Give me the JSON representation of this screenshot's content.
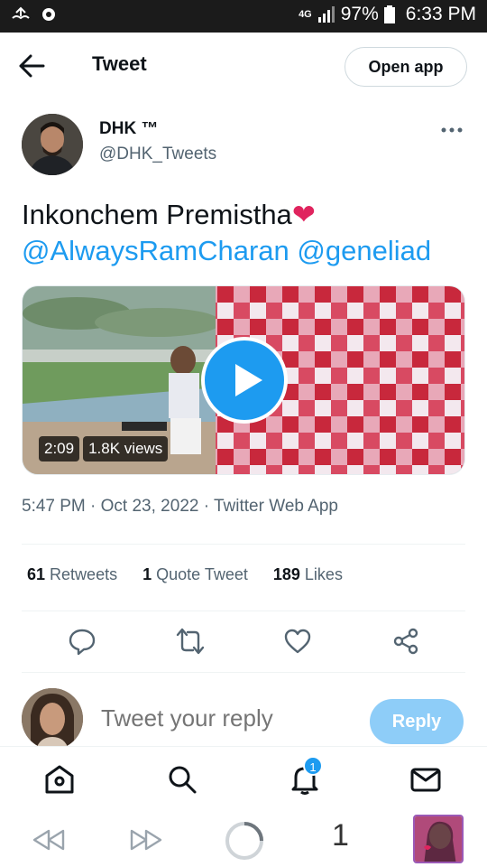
{
  "status_bar": {
    "network": "4G",
    "battery": "97%",
    "time": "6:33 PM"
  },
  "header": {
    "title": "Tweet",
    "open_app_label": "Open app"
  },
  "author": {
    "name": "DHK ™",
    "handle": "@DHK_Tweets"
  },
  "tweet": {
    "text": "Inkonchem Premistha",
    "emoji": "❤",
    "mentions": [
      "@AlwaysRamCharan",
      "@geneliad"
    ]
  },
  "video": {
    "duration": "2:09",
    "views": "1.8K views"
  },
  "meta": {
    "time": "5:47 PM",
    "date": "Oct 23, 2022",
    "source": "Twitter Web App",
    "separator": "·"
  },
  "stats": {
    "retweets_count": "61",
    "retweets_label": "Retweets",
    "quotes_count": "1",
    "quotes_label": "Quote Tweet",
    "likes_count": "189",
    "likes_label": "Likes"
  },
  "reply": {
    "placeholder": "Tweet your reply",
    "button_label": "Reply"
  },
  "bottom_nav": {
    "notifications_badge": "1",
    "items": [
      "home-icon",
      "search-icon",
      "bell-icon",
      "mail-icon"
    ]
  },
  "browser_bar": {
    "tab_count": "1"
  },
  "colors": {
    "accent": "#1d9bf0",
    "reply_button": "#8ecdf8",
    "muted_text": "#536471",
    "heart": "#e0245e"
  }
}
